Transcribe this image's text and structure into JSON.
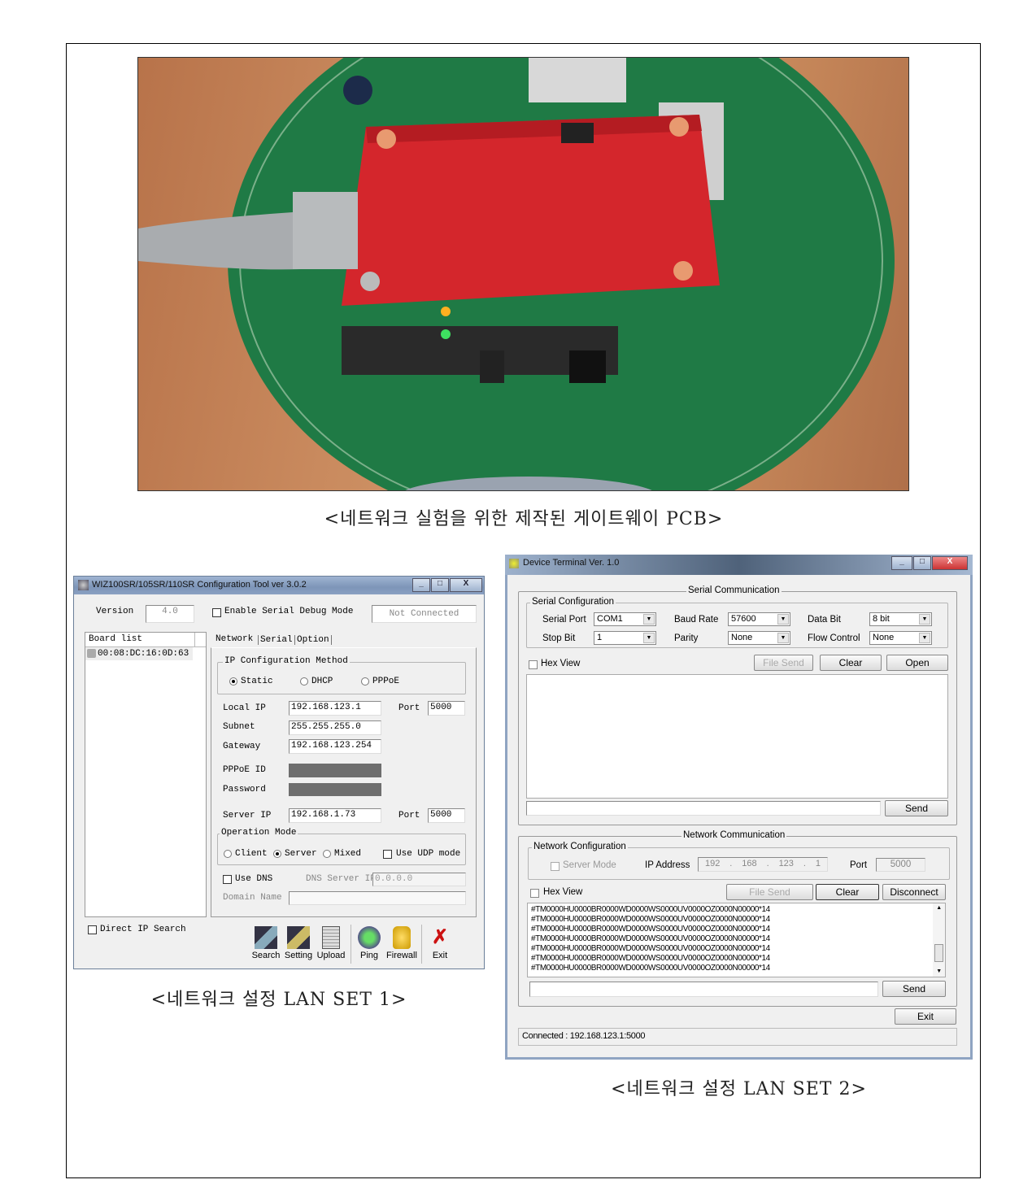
{
  "captions": {
    "photo": "<네트워크 실험을 위한 제작된 게이트웨이 PCB>",
    "lan1": "<네트워크 설정 LAN SET 1>",
    "lan2": "<네트워크 설정 LAN SET 2>"
  },
  "config_tool": {
    "title": "WIZ100SR/105SR/110SR Configuration Tool ver 3.0.2",
    "window_buttons": [
      "_",
      "□",
      "X"
    ],
    "version_label": "Version",
    "version_value": "4.0",
    "debug_mode_label": "Enable Serial Debug Mode",
    "debug_mode_checked": false,
    "connection_status": "Not Connected",
    "board_list_header": "Board list",
    "board_list_items": [
      "00:08:DC:16:0D:63"
    ],
    "tabs": [
      "Network",
      "Serial",
      "Option"
    ],
    "active_tab": "Network",
    "ip_method_title": "IP Configuration Method",
    "ip_methods": [
      "Static",
      "DHCP",
      "PPPoE"
    ],
    "ip_method_selected": "Static",
    "local_ip_label": "Local IP",
    "local_ip": "192.168.123.1",
    "port_label": "Port",
    "local_port": "5000",
    "subnet_label": "Subnet",
    "subnet": "255.255.255.0",
    "gateway_label": "Gateway",
    "gateway": "192.168.123.254",
    "pppoe_id_label": "PPPoE ID",
    "password_label": "Password",
    "server_ip_label": "Server IP",
    "server_ip": "192.168.1.73",
    "server_port": "5000",
    "op_mode_title": "Operation Mode",
    "op_modes": [
      "Client",
      "Server",
      "Mixed"
    ],
    "op_mode_selected": "Server",
    "udp_label": "Use UDP mode",
    "use_dns_label": "Use DNS",
    "dns_server_label": "DNS Server IP",
    "dns_server": "0.0.0.0",
    "domain_label": "Domain Name",
    "domain": "",
    "direct_ip_label": "Direct IP Search",
    "toolbar": [
      "Search",
      "Setting",
      "Upload",
      "Ping",
      "Firewall",
      "Exit"
    ]
  },
  "terminal": {
    "title": "Device Terminal Ver. 1.0",
    "window_buttons": [
      "_",
      "□",
      "X"
    ],
    "serial_comm_title": "Serial Communication",
    "serial_config_title": "Serial Configuration",
    "serial_port_label": "Serial Port",
    "serial_port": "COM1",
    "baud_label": "Baud Rate",
    "baud": "57600",
    "data_bit_label": "Data Bit",
    "data_bit": "8 bit",
    "stop_bit_label": "Stop Bit",
    "stop_bit": "1",
    "parity_label": "Parity",
    "parity": "None",
    "flow_label": "Flow Control",
    "flow": "None",
    "hex_view_label": "Hex View",
    "file_send": "File Send",
    "clear": "Clear",
    "open": "Open",
    "send": "Send",
    "net_comm_title": "Network Communication",
    "net_config_title": "Network Configuration",
    "server_mode_label": "Server Mode",
    "ip_label": "IP Address",
    "ip_octets": [
      "192",
      "168",
      "123",
      "1"
    ],
    "port_label": "Port",
    "port": "5000",
    "disconnect": "Disconnect",
    "log_lines": [
      "#TM0000HU0000BR0000WD0000WS0000UV0000OZ0000N00000*14",
      "#TM0000HU0000BR0000WD0000WS0000UV0000OZ0000N00000*14",
      "#TM0000HU0000BR0000WD0000WS0000UV0000OZ0000N00000*14",
      "#TM0000HU0000BR0000WD0000WS0000UV0000OZ0000N00000*14",
      "#TM0000HU0000BR0000WD0000WS0000UV0000OZ0000N00000*14",
      "#TM0000HU0000BR0000WD0000WS0000UV0000OZ0000N00000*14",
      "#TM0000HU0000BR0000WD0000WS0000UV0000OZ0000N00000*14"
    ],
    "exit": "Exit",
    "status": "Connected : 192.168.123.1:5000"
  }
}
